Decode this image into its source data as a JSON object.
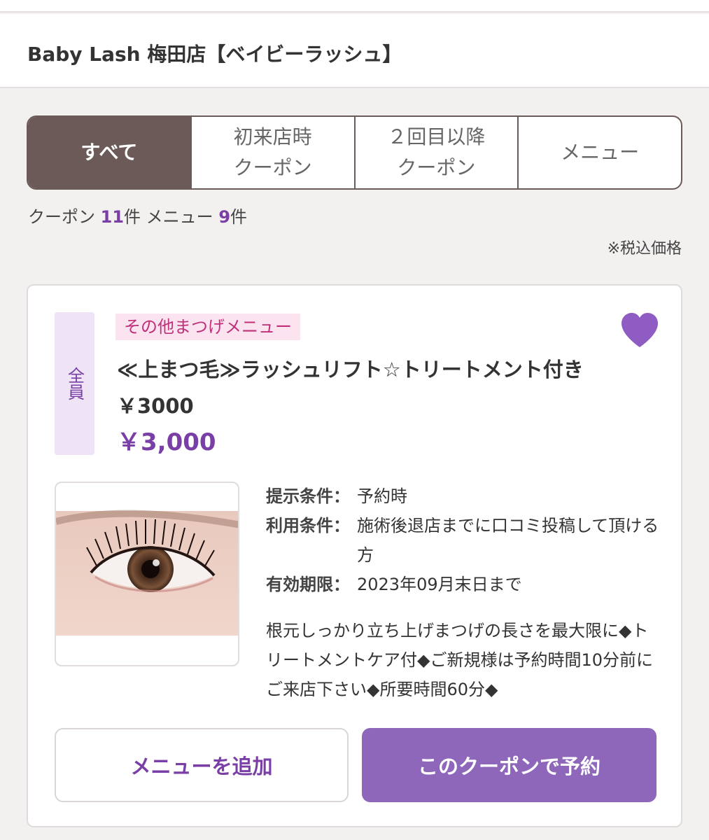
{
  "header": {
    "shop_name": "Baby Lash 梅田店【ベイビーラッシュ】"
  },
  "tabs": [
    {
      "label": "すべて",
      "active": true
    },
    {
      "label": "初来店時\nクーポン",
      "active": false
    },
    {
      "label": "２回目以降\nクーポン",
      "active": false
    },
    {
      "label": "メニュー",
      "active": false
    }
  ],
  "counts": {
    "coupon_label": "クーポン ",
    "coupon_count": "11",
    "coupon_unit": "件 メニュー ",
    "menu_count": "9",
    "menu_unit": "件"
  },
  "tax_note": "※税込価格",
  "coupon": {
    "badge": "全員",
    "category": "その他まつげメニュー",
    "title": "≪上まつ毛≫ラッシュリフト☆トリートメント付き　￥3000",
    "price": "￥3,000",
    "favorite_icon": "heart-icon",
    "conditions": [
      {
        "label": "提示条件：",
        "value": "予約時"
      },
      {
        "label": "利用条件：",
        "value": "施術後退店までに口コミ投稿して頂ける方"
      },
      {
        "label": "有効期限：",
        "value": "2023年09月末日まで"
      }
    ],
    "description": "根元しっかり立ち上げまつげの長さを最大限に◆トリートメントケア付◆ご新規様は予約時間10分前にご来店下さい◆所要時間60分◆",
    "add_menu_label": "メニューを追加",
    "reserve_label": "このクーポンで予約"
  },
  "colors": {
    "tab_active": "#6b5a57",
    "accent_purple": "#7a3fa6",
    "button_purple": "#8e67bb",
    "tag_pink": "#c0307a"
  }
}
